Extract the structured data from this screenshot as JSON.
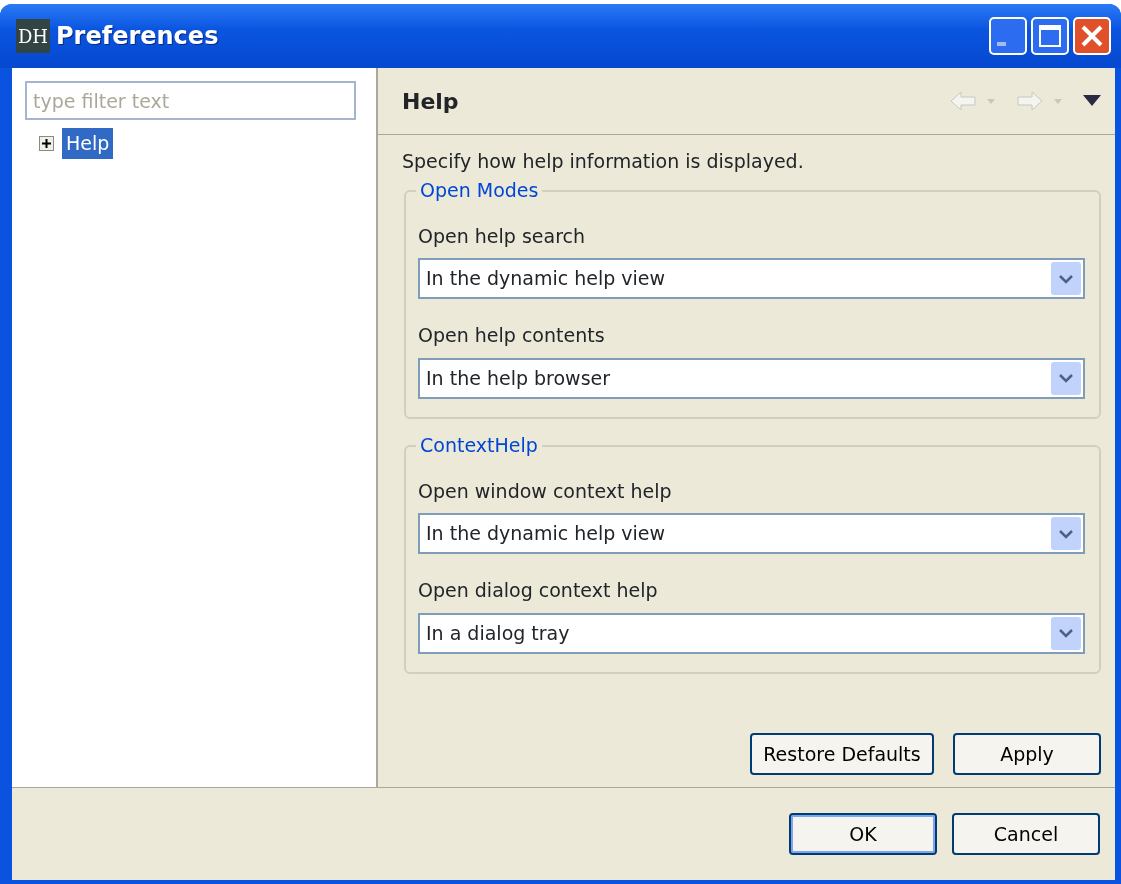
{
  "window": {
    "title": "Preferences",
    "icon_text": "DH"
  },
  "filter": {
    "placeholder": "type filter text"
  },
  "tree": [
    {
      "label": "Help",
      "selected": true,
      "expanded": false
    }
  ],
  "page": {
    "title": "Help",
    "description": "Specify how help information is displayed."
  },
  "groups": [
    {
      "title": "Open Modes",
      "fields": [
        {
          "label": "Open help search",
          "value": "In the dynamic help view"
        },
        {
          "label": "Open help contents",
          "value": "In the help browser"
        }
      ]
    },
    {
      "title": "ContextHelp",
      "fields": [
        {
          "label": "Open window context help",
          "value": "In the dynamic help view"
        },
        {
          "label": "Open dialog context help",
          "value": "In a dialog tray"
        }
      ]
    }
  ],
  "page_buttons": [
    "Restore Defaults",
    "Apply"
  ],
  "dialog_buttons": [
    {
      "label": "OK",
      "default": true
    },
    {
      "label": "Cancel",
      "default": false
    }
  ]
}
